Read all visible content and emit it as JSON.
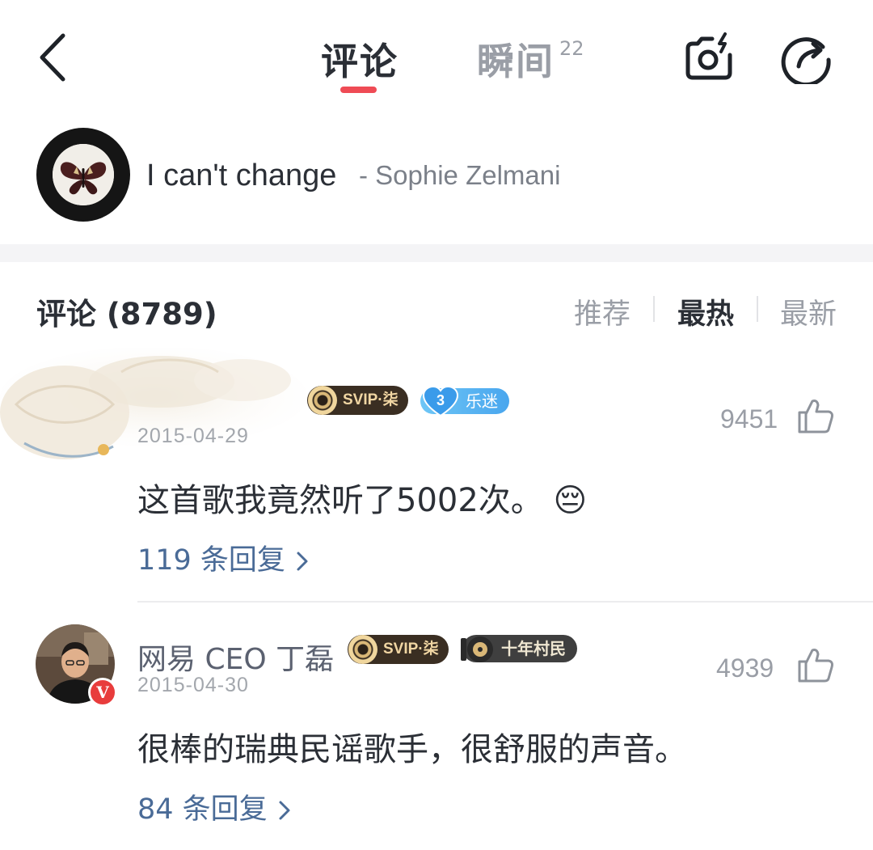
{
  "header": {
    "tabs": [
      {
        "label": "评论",
        "active": true
      },
      {
        "label": "瞬间",
        "count": "22",
        "active": false
      }
    ]
  },
  "song": {
    "title": "I can't change",
    "artist": "- Sophie Zelmani"
  },
  "comments_section": {
    "title": "评论 (8789)",
    "sort_options": [
      "推荐",
      "最热",
      "最新"
    ],
    "active_sort": "最热"
  },
  "comments": [
    {
      "username": "",
      "svip_badge": "SVIP·柒",
      "fan_badge": {
        "level": "3",
        "label": "乐迷"
      },
      "date": "2015-04-29",
      "text": "这首歌我竟然听了5002次。",
      "emoji": "😔",
      "replies": "119 条回复",
      "likes": "9451"
    },
    {
      "username": "网易 CEO 丁磊",
      "svip_badge": "SVIP·柒",
      "villager_badge": "十年村民",
      "verified": "V",
      "date": "2015-04-30",
      "text": "很棒的瑞典民谣歌手，很舒服的声音。",
      "replies": "84 条回复",
      "likes": "4939"
    }
  ],
  "colors": {
    "accent": "#ef4b55",
    "link": "#4a6b97",
    "svip_badge_bg": "#3a2e22",
    "fan_badge_bg": "#49a6ee"
  }
}
